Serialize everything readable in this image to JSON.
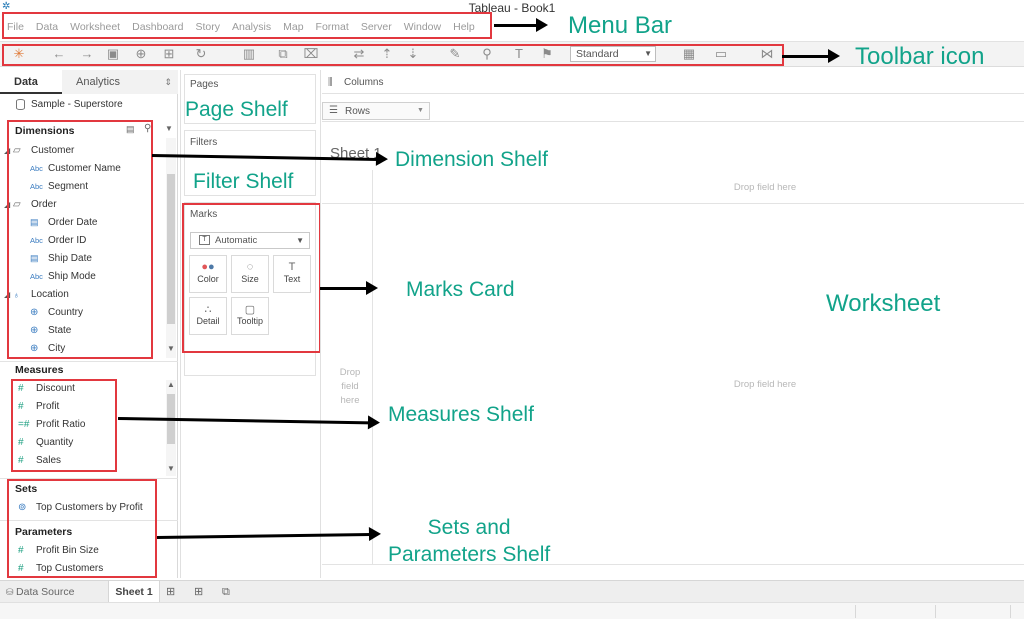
{
  "window": {
    "title": "Tableau - Book1"
  },
  "menu": [
    "File",
    "Data",
    "Worksheet",
    "Dashboard",
    "Story",
    "Analysis",
    "Map",
    "Format",
    "Server",
    "Window",
    "Help"
  ],
  "toolbar": {
    "fit_select": "Standard"
  },
  "data_pane": {
    "tabs": {
      "data": "Data",
      "analytics": "Analytics"
    },
    "datasource": "Sample - Superstore",
    "dimensions": {
      "header": "Dimensions",
      "items": [
        {
          "type": "folder",
          "label": "Customer"
        },
        {
          "type": "abc",
          "label": "Customer Name"
        },
        {
          "type": "abc",
          "label": "Segment"
        },
        {
          "type": "folder",
          "label": "Order"
        },
        {
          "type": "date",
          "label": "Order Date"
        },
        {
          "type": "abc",
          "label": "Order ID"
        },
        {
          "type": "date",
          "label": "Ship Date"
        },
        {
          "type": "abc",
          "label": "Ship Mode"
        },
        {
          "type": "hierarchy",
          "label": "Location"
        },
        {
          "type": "geo",
          "label": "Country"
        },
        {
          "type": "geo",
          "label": "State"
        },
        {
          "type": "geo",
          "label": "City"
        }
      ]
    },
    "measures": {
      "header": "Measures",
      "items": [
        "Discount",
        "Profit",
        "Profit Ratio",
        "Quantity",
        "Sales"
      ]
    },
    "sets": {
      "header": "Sets",
      "items": [
        "Top Customers by Profit"
      ]
    },
    "parameters": {
      "header": "Parameters",
      "items": [
        "Profit Bin Size",
        "Top Customers"
      ]
    },
    "abc_tag": "Abc"
  },
  "shelves": {
    "pages": "Pages",
    "filters": "Filters",
    "columns": "Columns",
    "rows": "Rows",
    "marks": {
      "label": "Marks",
      "type": "Automatic",
      "buttons": [
        "Color",
        "Size",
        "Text",
        "Detail",
        "Tooltip"
      ]
    }
  },
  "worksheet": {
    "title": "Sheet 1",
    "drop_top": "Drop field here",
    "drop_mid": "Drop field here",
    "drop_left": "Drop\nfield\nhere"
  },
  "bottom": {
    "datasource_tab": "Data Source",
    "sheet_tab": "Sheet 1"
  },
  "annotations": {
    "menu_bar": "Menu Bar",
    "toolbar_icon": "Toolbar icon",
    "page_shelf": "Page Shelf",
    "filter_shelf": "Filter Shelf",
    "dimension_shelf": "Dimension Shelf",
    "marks_card": "Marks Card",
    "worksheet": "Worksheet",
    "measures_shelf": "Measures Shelf",
    "sets_parameters": "Sets and\nParameters Shelf"
  },
  "colors": {
    "annotation": "#12a38a",
    "highlight_box": "#e2383f",
    "measure_icon": "#1ea082",
    "dimension_icon": "#3a7cc0"
  }
}
